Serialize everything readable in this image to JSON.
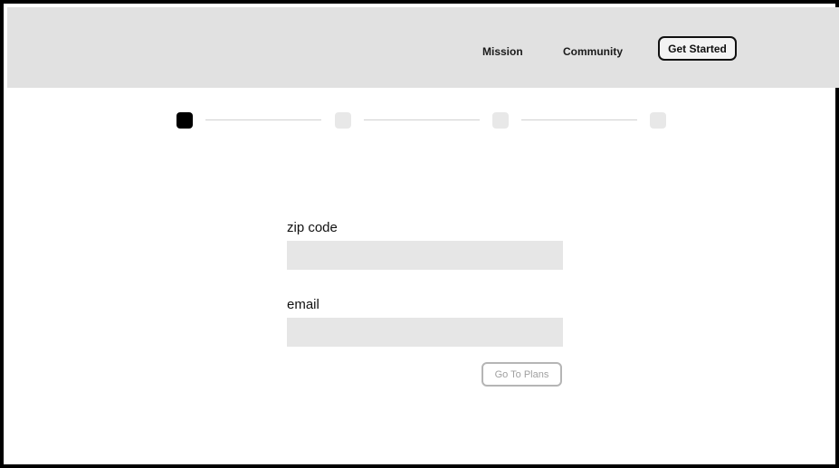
{
  "header": {
    "nav": {
      "mission_label": "Mission",
      "community_label": "Community"
    },
    "cta_label": "Get Started"
  },
  "stepper": {
    "current_step": 1,
    "total_steps": 4
  },
  "form": {
    "zip": {
      "label": "zip code",
      "value": "",
      "placeholder": ""
    },
    "email": {
      "label": "email",
      "value": "",
      "placeholder": ""
    },
    "submit_label": "Go To Plans"
  },
  "colors": {
    "frame_border": "#000000",
    "header_bg": "#e1e1e1",
    "input_bg": "#e6e6e6",
    "active_step": "#000000",
    "inactive_step": "#e8e8e8",
    "disabled_button_text": "#a0a0a0"
  }
}
